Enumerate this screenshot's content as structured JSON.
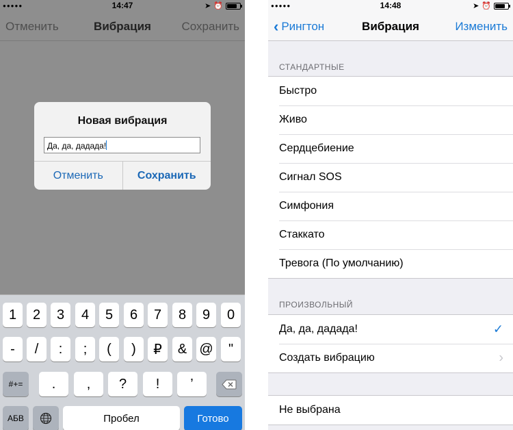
{
  "left": {
    "status": {
      "signal": "●●●●●",
      "time": "14:47"
    },
    "nav": {
      "left_label": "Отменить",
      "title": "Вибрация",
      "right_label": "Сохранить"
    },
    "alert": {
      "title": "Новая вибрация",
      "input_value": "Да, да, дадада!",
      "cancel_label": "Отменить",
      "save_label": "Сохранить"
    },
    "keyboard": {
      "row1": [
        "1",
        "2",
        "3",
        "4",
        "5",
        "6",
        "7",
        "8",
        "9",
        "0"
      ],
      "row2": [
        "-",
        "/",
        ":",
        ";",
        "(",
        ")",
        "₽",
        "&",
        "@",
        "\""
      ],
      "row3_mode": "#+=",
      "row3": [
        ".",
        ",",
        "?",
        "!",
        "’"
      ],
      "abc_label": "АБВ",
      "space_label": "Пробел",
      "done_label": "Готово"
    }
  },
  "right": {
    "status": {
      "signal": "●●●●●",
      "time": "14:48"
    },
    "nav": {
      "back_label": "Рингтон",
      "title": "Вибрация",
      "right_label": "Изменить"
    },
    "standard_header": "СТАНДАРТНЫЕ",
    "standard_items": [
      "Быстро",
      "Живо",
      "Сердцебиение",
      "Сигнал SOS",
      "Симфония",
      "Стаккато",
      "Тревога (По умолчанию)"
    ],
    "custom_header": "ПРОИЗВОЛЬНЫЙ",
    "custom_items": [
      {
        "label": "Да, да, дадада!",
        "selected": true
      },
      {
        "label": "Создать вибрацию",
        "disclosure": true
      }
    ],
    "none_label": "Не выбрана"
  },
  "colors": {
    "accent": "#1a7ad6",
    "done_key": "#1779e0",
    "dim_overlay": "#8e8e8e"
  }
}
